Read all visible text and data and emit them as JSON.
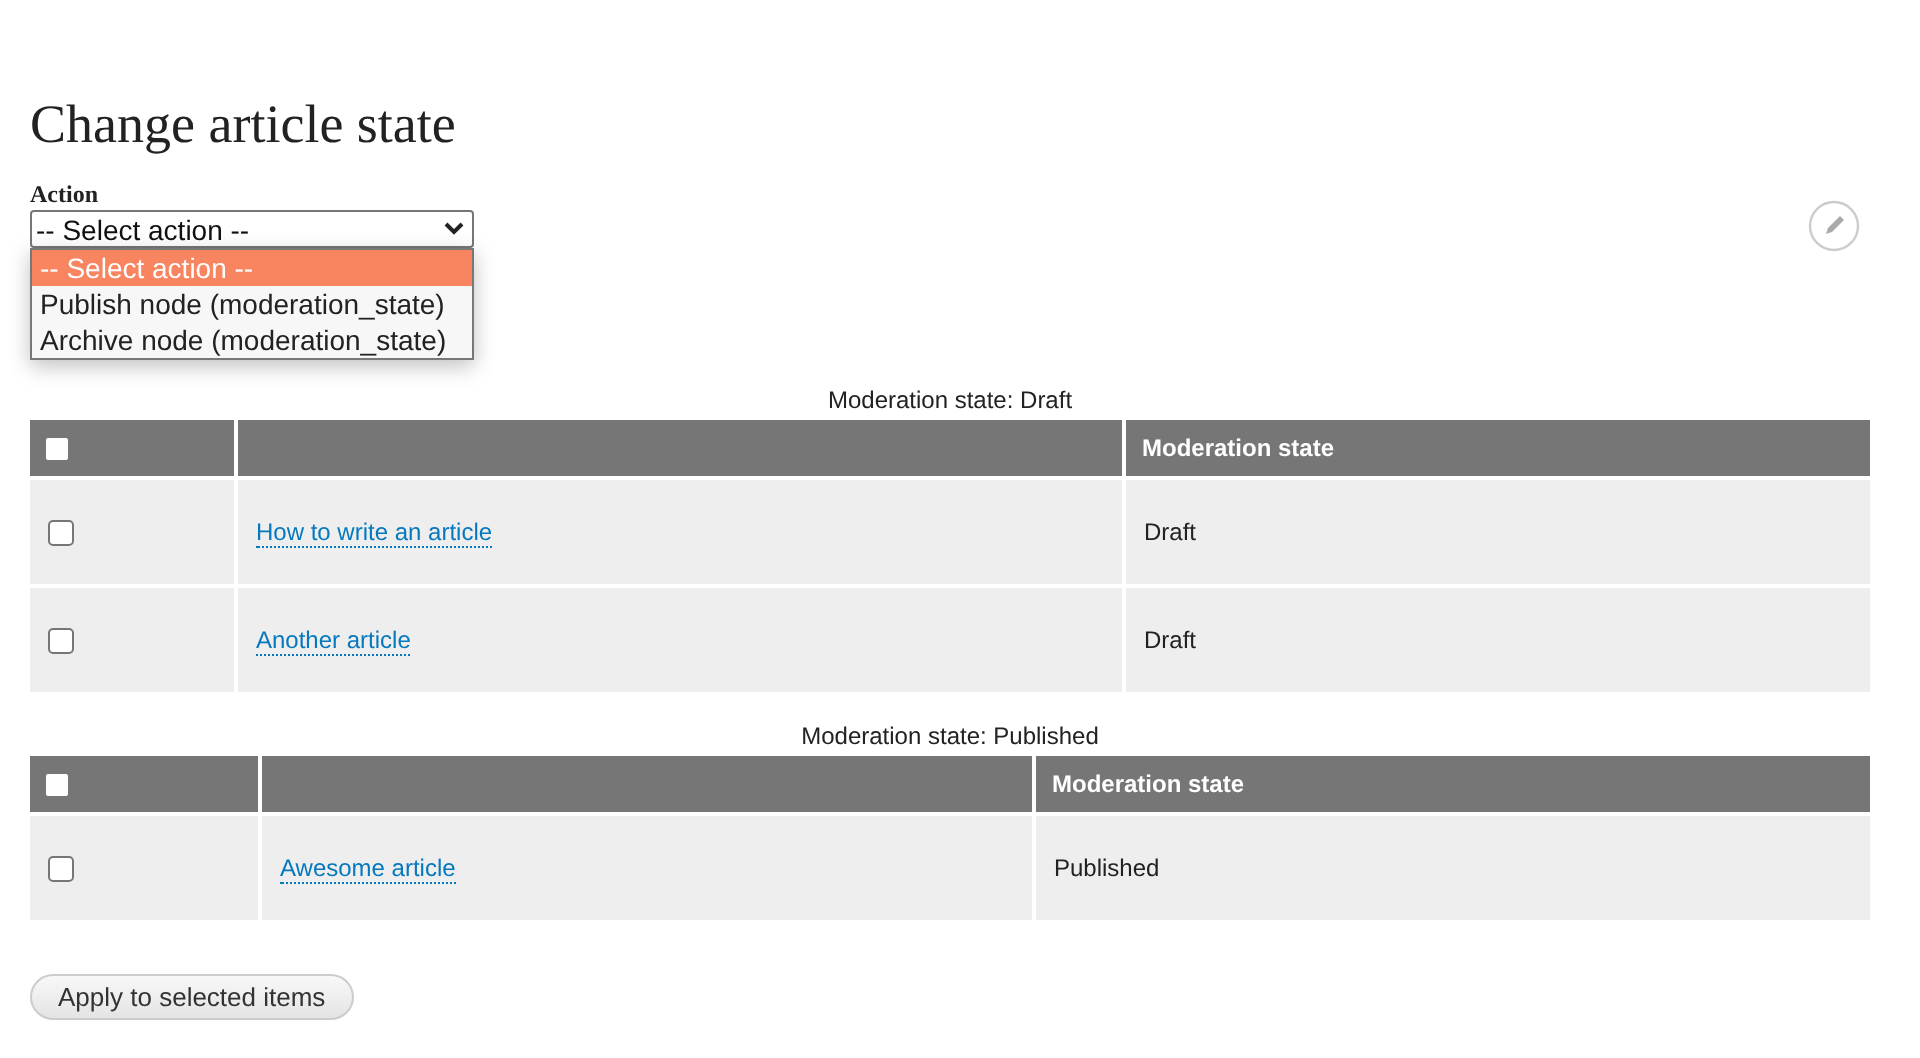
{
  "title": "Change article state",
  "action": {
    "label": "Action",
    "value": "-- Select action --",
    "expanded": true,
    "options": [
      {
        "label": "-- Select action --",
        "selected": true
      },
      {
        "label": "Publish node (moderation_state)",
        "selected": false
      },
      {
        "label": "Archive node (moderation_state)",
        "selected": false
      }
    ]
  },
  "groups": [
    {
      "caption": "Moderation state: Draft",
      "header_checked": false,
      "columns": [
        "",
        "Moderation state"
      ],
      "rows": [
        {
          "checked": false,
          "title": "How to write an article",
          "state": "Draft"
        },
        {
          "checked": false,
          "title": "Another article",
          "state": "Draft"
        }
      ]
    },
    {
      "caption": "Moderation state: Published",
      "header_checked": false,
      "columns": [
        "",
        "Moderation state"
      ],
      "rows": [
        {
          "checked": false,
          "title": "Awesome article",
          "state": "Published"
        }
      ]
    }
  ],
  "submit": "Apply to selected items"
}
